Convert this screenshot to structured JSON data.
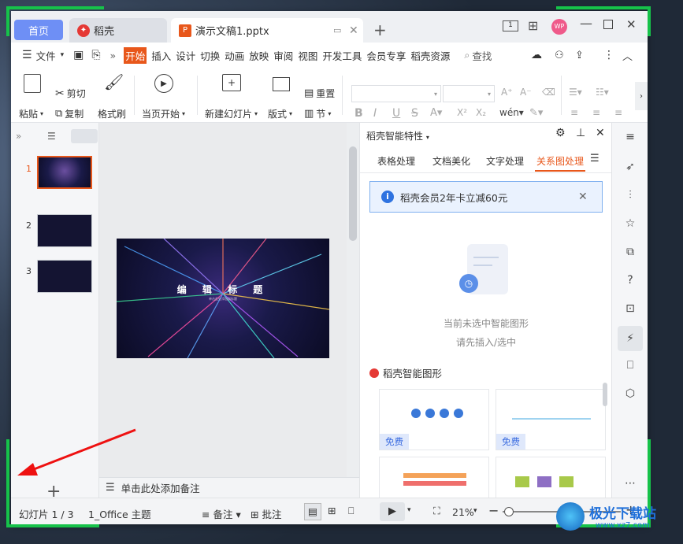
{
  "titlebar": {
    "tabs": [
      {
        "label": "首页"
      },
      {
        "label": "稻壳"
      },
      {
        "label": "演示文稿1.pptx"
      }
    ],
    "new_tab": "+",
    "avatar": "WP"
  },
  "menu": {
    "file": "文件",
    "items": [
      "开始",
      "插入",
      "设计",
      "切换",
      "动画",
      "放映",
      "审阅",
      "视图",
      "开发工具",
      "会员专享",
      "稻壳资源"
    ],
    "search": "查找"
  },
  "ribbon": {
    "paste": "粘贴",
    "cut": "剪切",
    "copy": "复制",
    "format_painter": "格式刷",
    "play_from_current": "当页开始",
    "new_slide": "新建幻灯片",
    "layout": "版式",
    "reset": "重置",
    "section": "节"
  },
  "leftpane": {
    "slides": [
      "1",
      "2",
      "3"
    ],
    "add": "+"
  },
  "slide": {
    "title": "编 辑 标 题",
    "subtitle": "单击此处添加副标题"
  },
  "notes": {
    "placeholder": "单击此处添加备注"
  },
  "rpanel": {
    "title": "稻壳智能特性",
    "tabs": [
      "表格处理",
      "文档美化",
      "文字处理",
      "关系图处理"
    ],
    "active_tab": "关系图处理",
    "promo": "稻壳会员2年卡立减60元",
    "empty_line1": "当前未选中智能图形",
    "empty_line2": "请先插入/选中",
    "section_title": "稻壳智能图形",
    "free_badge": "免费"
  },
  "status": {
    "slide_counter": "幻灯片 1 / 3",
    "theme": "1_Office 主题",
    "notes": "备注",
    "comments": "批注",
    "zoom": "21%"
  },
  "watermark": {
    "text": "极光下载站",
    "sub": "www.xz7.com"
  },
  "colors": {
    "accent": "#e8571b",
    "selection": "#6e8ff5",
    "green_frame": "#16c24a"
  }
}
